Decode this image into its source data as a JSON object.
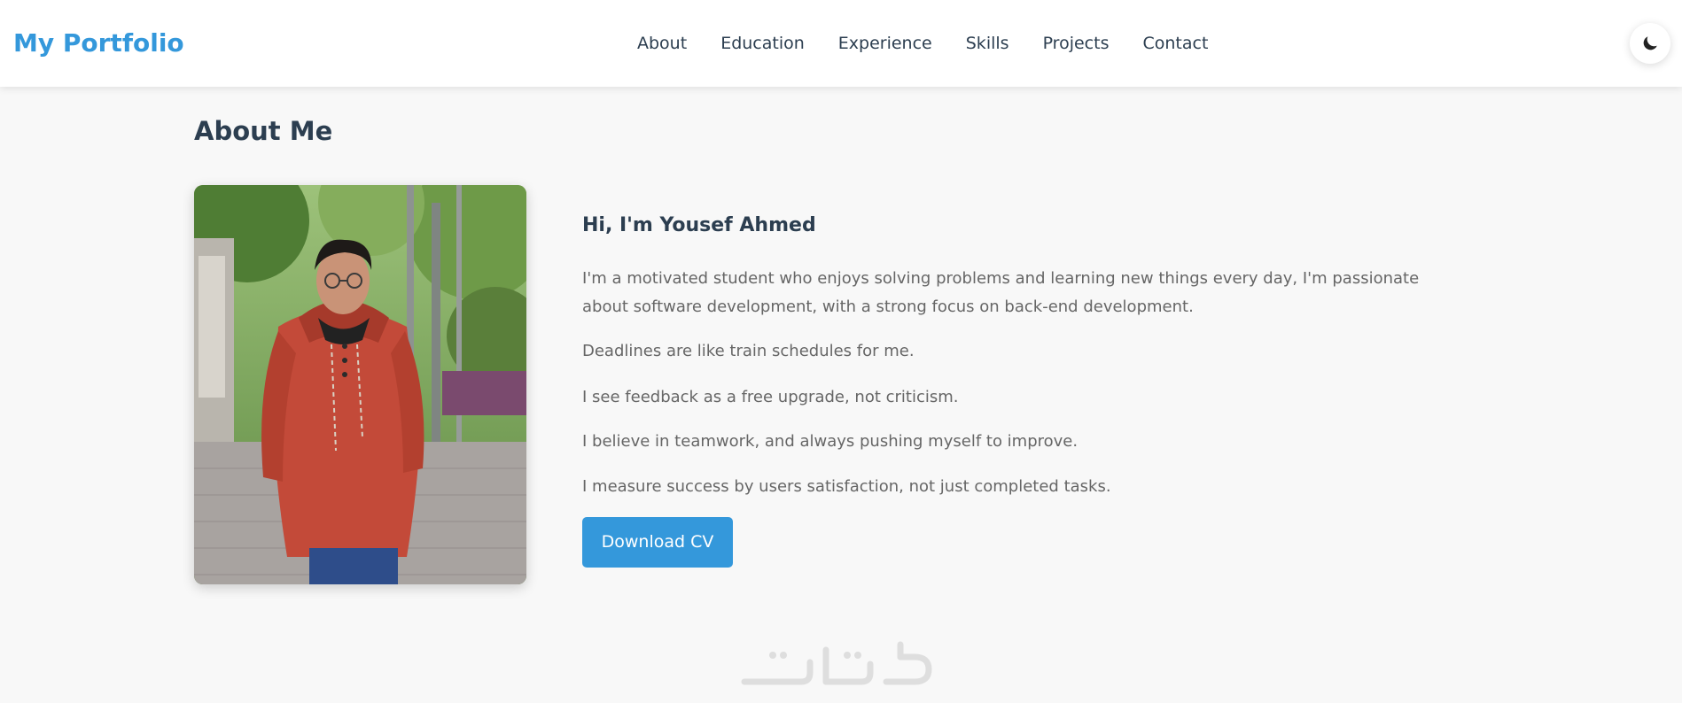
{
  "header": {
    "brand": "My Portfolio",
    "nav": [
      {
        "label": "About"
      },
      {
        "label": "Education"
      },
      {
        "label": "Experience"
      },
      {
        "label": "Skills"
      },
      {
        "label": "Projects"
      },
      {
        "label": "Contact"
      }
    ],
    "theme_toggle_icon": "moon-icon"
  },
  "about": {
    "title": "About Me",
    "greeting": "Hi, I'm Yousef Ahmed",
    "paragraphs": [
      "I'm a motivated student who enjoys solving problems and learning new things every day, I'm passionate about software development, with a strong focus on back-end development.",
      "Deadlines are like train schedules for me.",
      "I see feedback as a free upgrade, not criticism.",
      "I believe in teamwork, and always pushing myself to improve.",
      "I measure success by users satisfaction, not just completed tasks."
    ],
    "cv_button": "Download CV"
  },
  "watermark": "خمسات",
  "colors": {
    "accent": "#3498db",
    "heading": "#2c3e50",
    "body_text": "#666666",
    "background": "#f8f8f8"
  }
}
